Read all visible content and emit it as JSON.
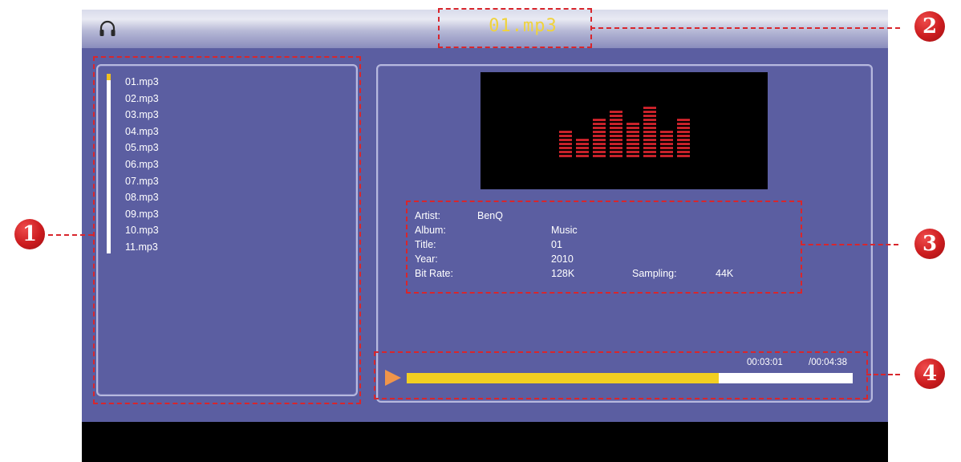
{
  "header": {
    "now_playing": "01.mp3",
    "icon": "headphones-icon"
  },
  "playlist": {
    "items": [
      "01.mp3",
      "02.mp3",
      "03.mp3",
      "04.mp3",
      "05.mp3",
      "06.mp3",
      "07.mp3",
      "08.mp3",
      "09.mp3",
      "10.mp3",
      "11.mp3"
    ],
    "selected_index": 0
  },
  "visualizer": {
    "levels": [
      7,
      5,
      10,
      12,
      9,
      13,
      7,
      10
    ]
  },
  "info": {
    "artist_label": "Artist:",
    "artist_value": "BenQ",
    "album_label": "Album:",
    "album_value": "Music",
    "title_label": "Title:",
    "title_value": "01",
    "year_label": "Year:",
    "year_value": "2010",
    "bitrate_label": "Bit Rate:",
    "bitrate_value": "128K",
    "sampling_label": "Sampling:",
    "sampling_value": "44K"
  },
  "progress": {
    "elapsed": "00:03:01",
    "total": "/00:04:38",
    "fraction": 0.7
  },
  "callouts": [
    "1",
    "2",
    "3",
    "4"
  ],
  "colors": {
    "screen_bg": "#5b5ea1",
    "title": "#f0d33c",
    "progress": "#f2cf22",
    "callout": "#d8262c",
    "visualizer": "#c8222a"
  }
}
